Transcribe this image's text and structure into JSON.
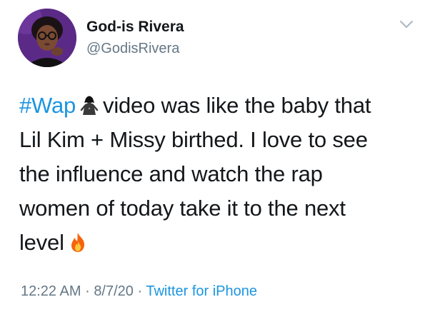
{
  "tweet": {
    "author": {
      "display_name": "God-is Rivera",
      "handle": "@GodisRivera"
    },
    "menu_icon": "chevron-down-icon",
    "text": {
      "hashtag": "#Wap",
      "hashtag_emoji": "woman-silhouette-emoji",
      "line1_rest": "video was like the baby that",
      "line2": "Lil Kim + Missy birthed. I love to see",
      "line3": "the influence and watch the rap",
      "line4": "women of today take it to the next",
      "line5": "level",
      "trailing_emoji": "fire-emoji"
    },
    "meta": {
      "time": "12:22 AM",
      "separator": "·",
      "date": "8/7/20",
      "source": "Twitter for iPhone"
    }
  },
  "colors": {
    "link": "#1b95e0",
    "secondary_text": "#657786",
    "primary_text": "#14171a",
    "avatar_bg": "#5b2a86",
    "fire_outer": "#f7630c",
    "fire_inner": "#ffc83d"
  }
}
